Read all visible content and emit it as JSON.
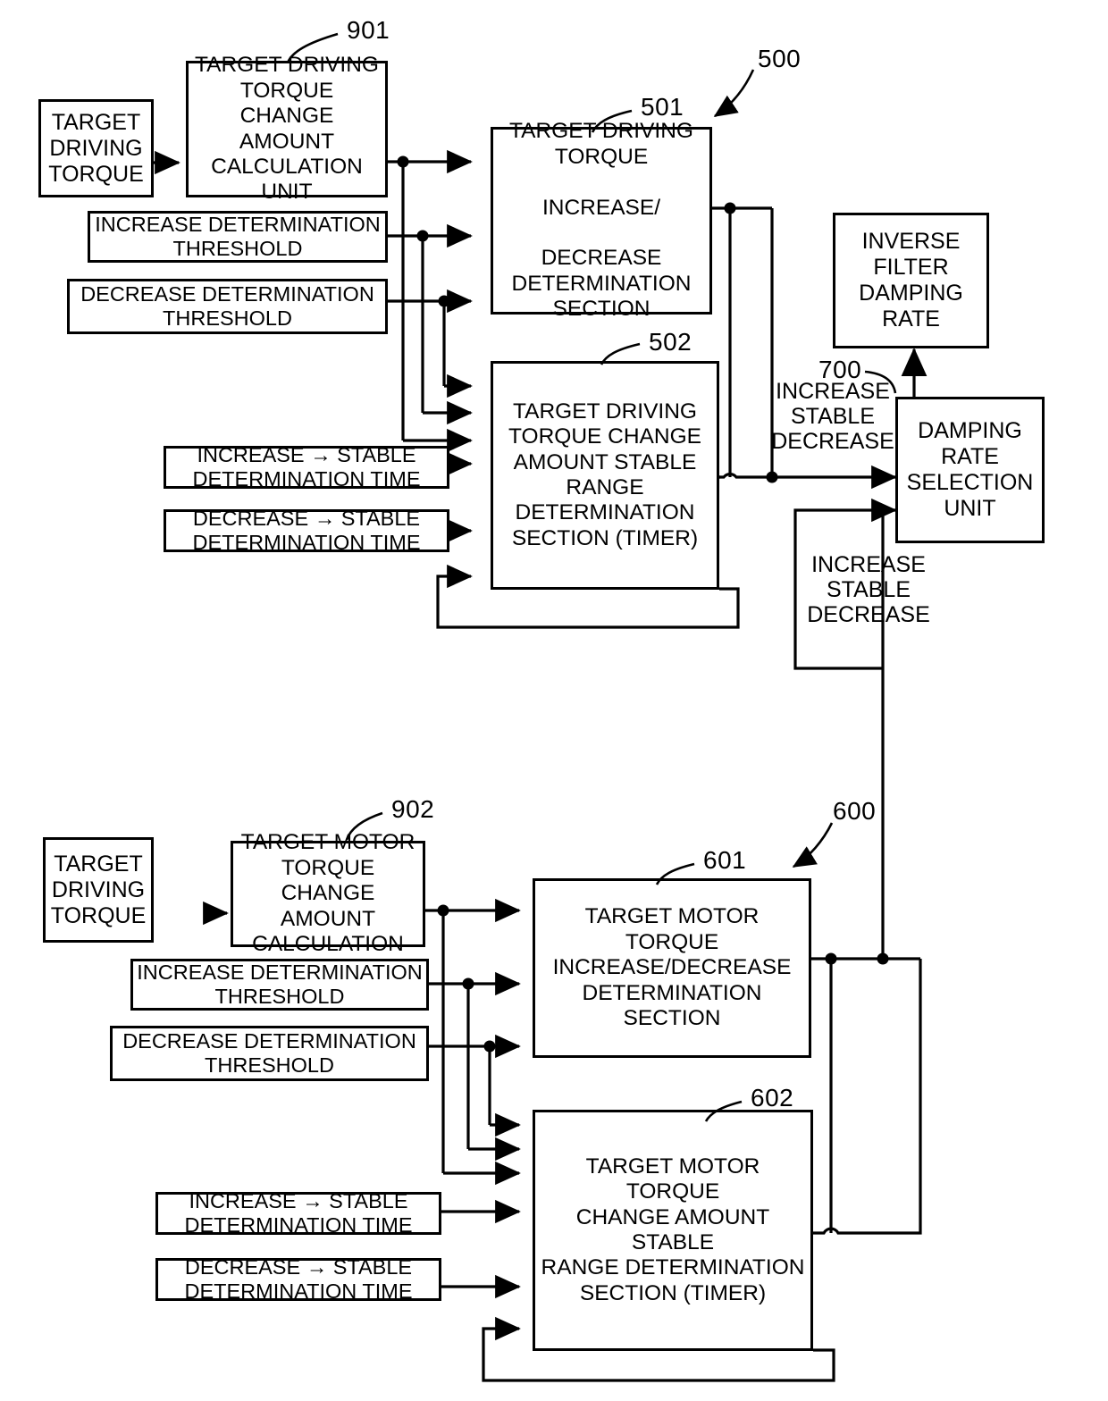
{
  "figure": {
    "type": "patent-block-diagram",
    "background": "#ffffff",
    "line_color": "#000000"
  },
  "upper_section": {
    "ref_number": "500",
    "blocks": {
      "input_torque": {
        "label": "TARGET\nDRIVING\nTORQUE"
      },
      "calc_unit": {
        "ref": "901",
        "label": "TARGET DRIVING\nTORQUE CHANGE\nAMOUNT\nCALCULATION\nUNIT"
      },
      "increase_threshold": {
        "label": "INCREASE DETERMINATION\nTHRESHOLD"
      },
      "decrease_threshold": {
        "label": "DECREASE DETERMINATION\nTHRESHOLD"
      },
      "incdec_section": {
        "ref": "501",
        "label": "TARGET DRIVING\nTORQUE\n\nINCREASE/\n\nDECREASE\nDETERMINATION\nSECTION"
      },
      "increase_stable_time": {
        "label": "INCREASE  →  STABLE\nDETERMINATION TIME"
      },
      "decrease_stable_time": {
        "label": "DECREASE  →  STABLE\nDETERMINATION TIME"
      },
      "stable_range_section": {
        "ref": "502",
        "label": "TARGET DRIVING\nTORQUE CHANGE\nAMOUNT STABLE\nRANGE\nDETERMINATION\nSECTION (TIMER)"
      }
    }
  },
  "right_section": {
    "ref_number": "700",
    "blocks": {
      "inverse_filter": {
        "label": "INVERSE\nFILTER\nDAMPING\nRATE"
      },
      "damping_selection": {
        "label": "DAMPING\nRATE\nSELECTION\nUNIT"
      }
    },
    "signal_labels": [
      {
        "name": "upper-signal",
        "text": "INCREASE\nSTABLE\nDECREASE"
      },
      {
        "name": "lower-signal",
        "text": "INCREASE\nSTABLE\nDECREASE"
      }
    ]
  },
  "lower_section": {
    "ref_number": "600",
    "blocks": {
      "input_torque": {
        "label": "TARGET\nDRIVING\nTORQUE"
      },
      "calc_unit": {
        "ref": "902",
        "label": "TARGET MOTOR\nTORQUE CHANGE\nAMOUNT\nCALCULATION"
      },
      "increase_threshold": {
        "label": "INCREASE DETERMINATION\nTHRESHOLD"
      },
      "decrease_threshold": {
        "label": "DECREASE DETERMINATION\nTHRESHOLD"
      },
      "incdec_section": {
        "ref": "601",
        "label": "TARGET MOTOR TORQUE\nINCREASE/DECREASE\nDETERMINATION\nSECTION"
      },
      "increase_stable_time": {
        "label": "INCREASE  →  STABLE\nDETERMINATION TIME"
      },
      "decrease_stable_time": {
        "label": "DECREASE  →  STABLE\nDETERMINATION TIME"
      },
      "stable_range_section": {
        "ref": "602",
        "label": "TARGET MOTOR TORQUE\nCHANGE AMOUNT STABLE\nRANGE DETERMINATION\nSECTION (TIMER)"
      }
    }
  }
}
